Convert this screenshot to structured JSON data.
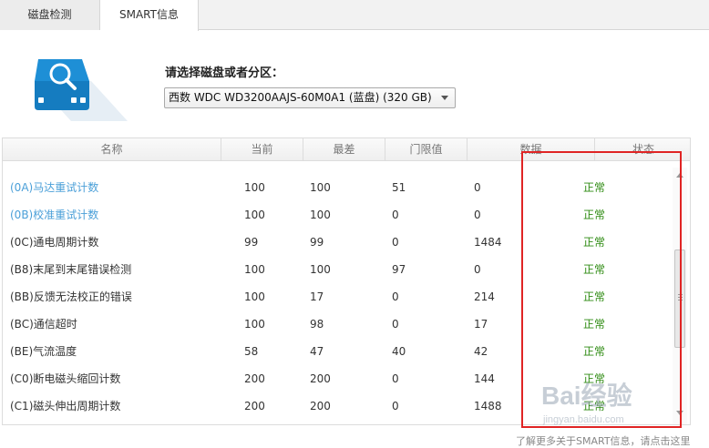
{
  "tabs": [
    {
      "label": "磁盘检测",
      "active": false
    },
    {
      "label": "SMART信息",
      "active": true
    }
  ],
  "disk_selector": {
    "label": "请选择磁盘或者分区：",
    "selected": "西数 WDC WD3200AAJS-60M0A1 (蓝盘)  (320 GB)"
  },
  "table": {
    "headers": [
      "名称",
      "当前",
      "最差",
      "门限值",
      "数据",
      "状态"
    ],
    "rows": [
      {
        "name": "(0A)马达重试计数",
        "current": "100",
        "worst": "100",
        "threshold": "51",
        "data": "0",
        "status": "正常",
        "highlight": true
      },
      {
        "name": "(0B)校准重试计数",
        "current": "100",
        "worst": "100",
        "threshold": "0",
        "data": "0",
        "status": "正常",
        "highlight": true
      },
      {
        "name": "(0C)通电周期计数",
        "current": "99",
        "worst": "99",
        "threshold": "0",
        "data": "1484",
        "status": "正常",
        "highlight": false
      },
      {
        "name": "(B8)末尾到末尾错误检测",
        "current": "100",
        "worst": "100",
        "threshold": "97",
        "data": "0",
        "status": "正常",
        "highlight": false
      },
      {
        "name": "(BB)反馈无法校正的错误",
        "current": "100",
        "worst": "17",
        "threshold": "0",
        "data": "214",
        "status": "正常",
        "highlight": false
      },
      {
        "name": "(BC)通信超时",
        "current": "100",
        "worst": "98",
        "threshold": "0",
        "data": "17",
        "status": "正常",
        "highlight": false
      },
      {
        "name": "(BE)气流温度",
        "current": "58",
        "worst": "47",
        "threshold": "40",
        "data": "42",
        "status": "正常",
        "highlight": false
      },
      {
        "name": "(C0)断电磁头缩回计数",
        "current": "200",
        "worst": "200",
        "threshold": "0",
        "data": "144",
        "status": "正常",
        "highlight": false
      },
      {
        "name": "(C1)磁头伸出周期计数",
        "current": "200",
        "worst": "200",
        "threshold": "0",
        "data": "1488",
        "status": "正常",
        "highlight": false
      }
    ]
  },
  "footer": {
    "text": "了解更多关于SMART信息，请点击这里"
  },
  "watermark": {
    "text": "Bai经验",
    "sub": "jingyan.baidu.com"
  },
  "colors": {
    "link_blue": "#4a9fd8",
    "ok_green": "#2e8b12",
    "highlight_red": "#e02424",
    "icon_blue": "#1e8fd6"
  }
}
